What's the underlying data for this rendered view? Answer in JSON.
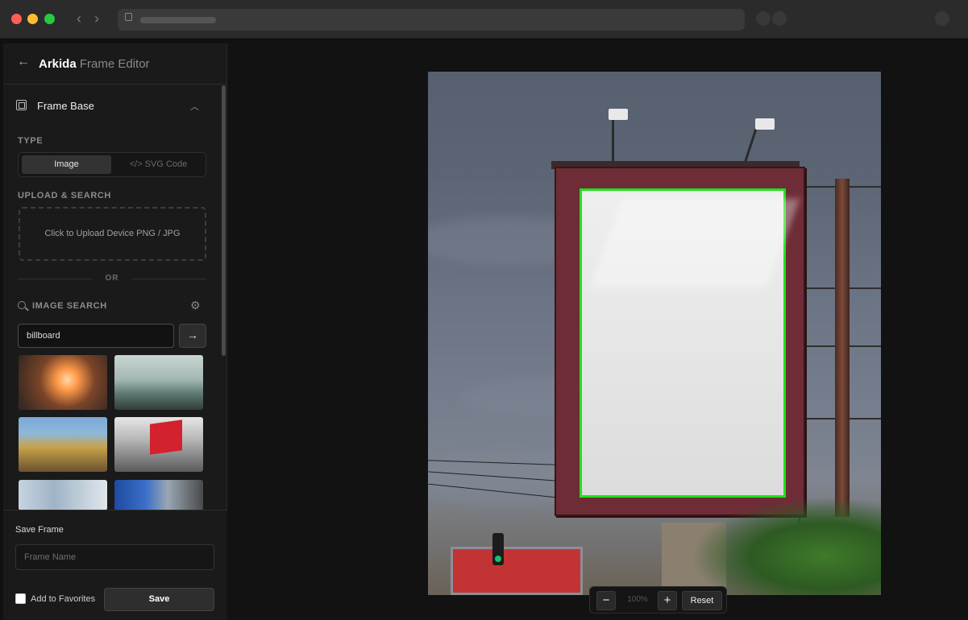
{
  "app": {
    "title_bold": "Arkida",
    "title_rest": " Frame Editor"
  },
  "frame_base": {
    "section_title": "Frame Base",
    "type_label": "TYPE",
    "type_options": [
      "Image",
      "</> SVG Code"
    ],
    "type_selected": "Image",
    "upload_label": "UPLOAD & SEARCH",
    "upload_text": "Click to Upload Device PNG / JPG",
    "or_text": "OR",
    "image_search_label": "IMAGE SEARCH",
    "search_value": "billboard",
    "search_go": "→",
    "results": [
      "sunset-blur",
      "park-trees",
      "city-buildings",
      "coca-cola-billboard",
      "street-billboards",
      "blue-billboard"
    ]
  },
  "save": {
    "title": "Save Frame",
    "name_placeholder": "Frame Name",
    "favorites_label": "Add to Favorites",
    "button": "Save"
  },
  "zoom": {
    "minus": "−",
    "plus": "+",
    "level": "100%",
    "reset": "Reset"
  },
  "colors": {
    "frame_outline": "#1de21d",
    "accent": "#2e2e2e"
  }
}
